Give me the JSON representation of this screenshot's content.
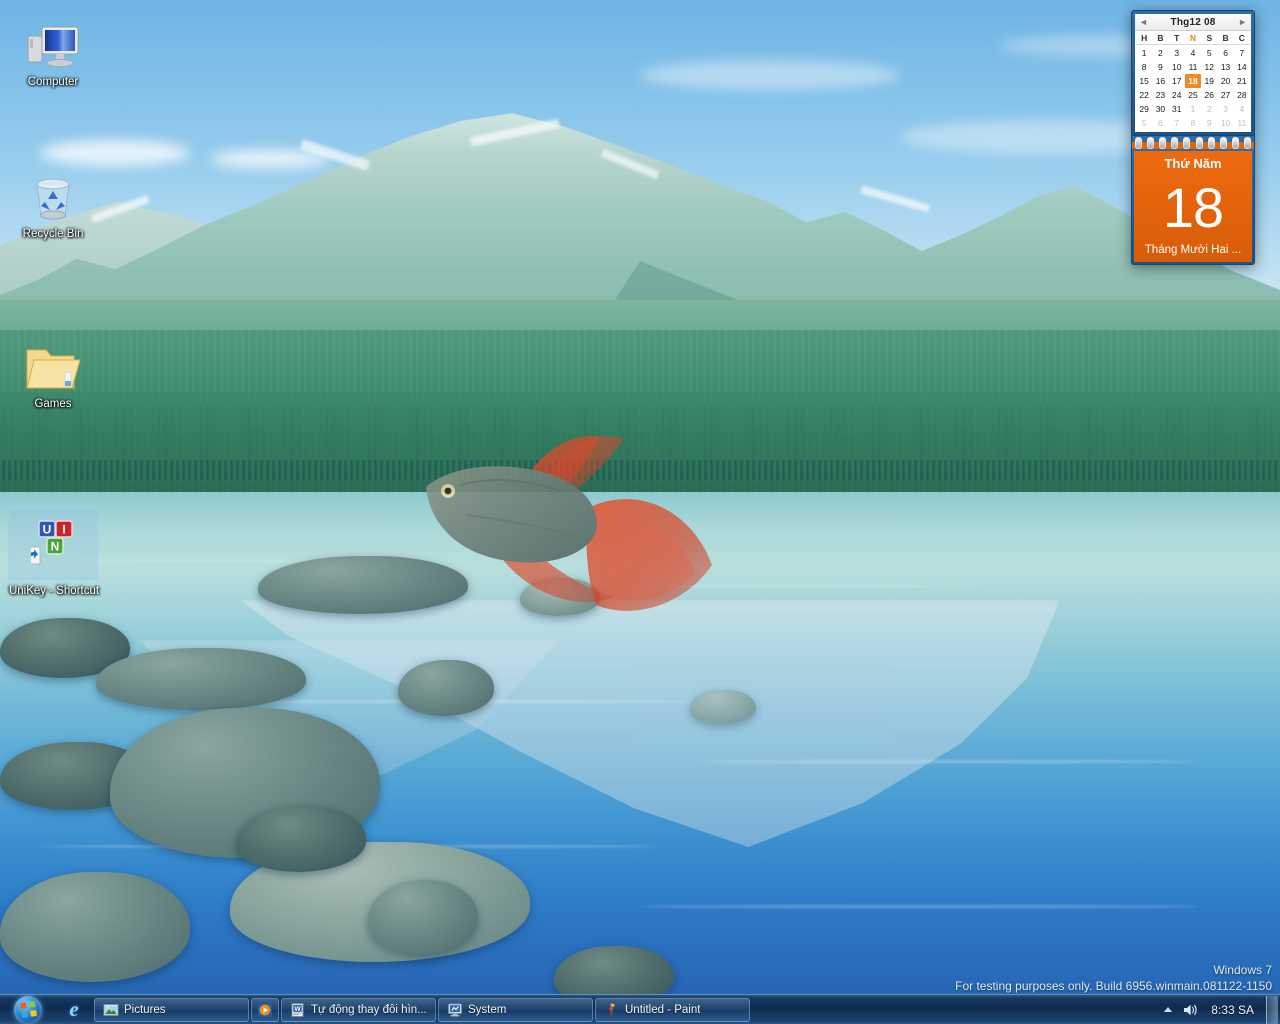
{
  "desktop": {
    "icons": [
      {
        "name": "computer",
        "label": "Computer",
        "icon": "computer-icon",
        "selected": false
      },
      {
        "name": "recycle-bin",
        "label": "Recycle Bin",
        "icon": "recycle-bin-icon",
        "selected": false
      },
      {
        "name": "games",
        "label": "Games",
        "icon": "folder-icon",
        "selected": false
      },
      {
        "name": "unikey",
        "label": "UniKey - Shortcut",
        "icon": "unikey-icon",
        "selected": true
      }
    ]
  },
  "gadget": {
    "name": "calendar-gadget",
    "header": {
      "title": "Thg12 08",
      "prev_label": "◄",
      "next_label": "►"
    },
    "day_headers": [
      "H",
      "B",
      "T",
      "N",
      "S",
      "B",
      "C"
    ],
    "sunday_index": 3,
    "weeks": [
      [
        {
          "d": "1"
        },
        {
          "d": "2"
        },
        {
          "d": "3"
        },
        {
          "d": "4"
        },
        {
          "d": "5"
        },
        {
          "d": "6"
        },
        {
          "d": "7"
        }
      ],
      [
        {
          "d": "8"
        },
        {
          "d": "9"
        },
        {
          "d": "10"
        },
        {
          "d": "11"
        },
        {
          "d": "12"
        },
        {
          "d": "13"
        },
        {
          "d": "14"
        }
      ],
      [
        {
          "d": "15"
        },
        {
          "d": "16"
        },
        {
          "d": "17"
        },
        {
          "d": "18",
          "today": true
        },
        {
          "d": "19"
        },
        {
          "d": "20"
        },
        {
          "d": "21"
        }
      ],
      [
        {
          "d": "22"
        },
        {
          "d": "23"
        },
        {
          "d": "24"
        },
        {
          "d": "25"
        },
        {
          "d": "26"
        },
        {
          "d": "27"
        },
        {
          "d": "28"
        }
      ],
      [
        {
          "d": "29"
        },
        {
          "d": "30"
        },
        {
          "d": "31"
        },
        {
          "d": "1",
          "muted": true
        },
        {
          "d": "2",
          "muted": true
        },
        {
          "d": "3",
          "muted": true
        },
        {
          "d": "4",
          "muted": true
        }
      ],
      [
        {
          "d": "5",
          "muted": true
        },
        {
          "d": "6",
          "muted": true
        },
        {
          "d": "7",
          "muted": true
        },
        {
          "d": "8",
          "muted": true
        },
        {
          "d": "9",
          "muted": true
        },
        {
          "d": "10",
          "muted": true
        },
        {
          "d": "11",
          "muted": true
        }
      ]
    ],
    "sheet": {
      "weekday": "Thứ Năm",
      "day_number": "18",
      "month": "Tháng Mười Hai ..."
    },
    "accent_color": "#ee6a10",
    "frame_color": "#2e6ca8"
  },
  "watermark": {
    "line1": "Windows  7",
    "line2": "For testing purposes only. Build 6956.winmain.081122-1150"
  },
  "taskbar": {
    "start_label": "Start",
    "quick_launch": [
      {
        "name": "internet-explorer-icon",
        "label": "Internet Explorer"
      }
    ],
    "buttons": [
      {
        "name": "taskbar-item-pictures",
        "label": "Pictures",
        "icon": "picture-icon"
      },
      {
        "name": "taskbar-item-media",
        "label": "",
        "icon": "media-player-icon"
      },
      {
        "name": "taskbar-item-document",
        "label": "Tự động thay đổi hìn...",
        "icon": "document-icon"
      },
      {
        "name": "taskbar-item-system",
        "label": "System",
        "icon": "system-icon"
      },
      {
        "name": "taskbar-item-paint",
        "label": "Untitled - Paint",
        "icon": "paint-icon"
      }
    ],
    "tray": {
      "show_hidden_label": "Show hidden icons",
      "volume_label": "Volume",
      "clock": "8:33 SA"
    },
    "show_desktop_label": "Show desktop"
  }
}
